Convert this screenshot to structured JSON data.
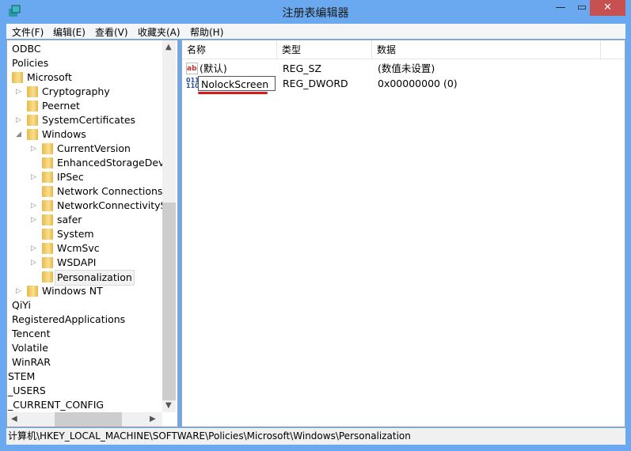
{
  "window": {
    "title": "注册表编辑器",
    "min": "—",
    "max": "▭",
    "close": "✕"
  },
  "menu": [
    "文件(F)",
    "编辑(E)",
    "查看(V)",
    "收藏夹(A)",
    "帮助(H)"
  ],
  "tree": [
    {
      "label": "ODBC",
      "level": 0,
      "folder": false
    },
    {
      "label": "Policies",
      "level": 0,
      "folder": false
    },
    {
      "label": "Microsoft",
      "level": 0,
      "folder": true
    },
    {
      "label": "Cryptography",
      "level": 1,
      "folder": true,
      "expander": "collapsed"
    },
    {
      "label": "Peernet",
      "level": 1,
      "folder": true
    },
    {
      "label": "SystemCertificates",
      "level": 1,
      "folder": true,
      "expander": "collapsed"
    },
    {
      "label": "Windows",
      "level": 1,
      "folder": true,
      "expander": "expanded"
    },
    {
      "label": "CurrentVersion",
      "level": 2,
      "folder": true,
      "expander": "collapsed"
    },
    {
      "label": "EnhancedStorageDevic",
      "level": 2,
      "folder": true
    },
    {
      "label": "IPSec",
      "level": 2,
      "folder": true,
      "expander": "collapsed"
    },
    {
      "label": "Network Connections",
      "level": 2,
      "folder": true
    },
    {
      "label": "NetworkConnectivitySta",
      "level": 2,
      "folder": true,
      "expander": "collapsed"
    },
    {
      "label": "safer",
      "level": 2,
      "folder": true,
      "expander": "collapsed"
    },
    {
      "label": "System",
      "level": 2,
      "folder": true
    },
    {
      "label": "WcmSvc",
      "level": 2,
      "folder": true,
      "expander": "collapsed"
    },
    {
      "label": "WSDAPI",
      "level": 2,
      "folder": true,
      "expander": "collapsed"
    },
    {
      "label": "Personalization",
      "level": 2,
      "folder": true,
      "selected": true
    },
    {
      "label": "Windows NT",
      "level": 1,
      "folder": true,
      "expander": "collapsed"
    },
    {
      "label": "QiYi",
      "level": 0,
      "folder": false
    },
    {
      "label": "RegisteredApplications",
      "level": 0,
      "folder": false
    },
    {
      "label": "Tencent",
      "level": 0,
      "folder": false
    },
    {
      "label": "Volatile",
      "level": 0,
      "folder": false
    },
    {
      "label": "WinRAR",
      "level": 0,
      "folder": false
    },
    {
      "label": "STEM",
      "level": -1,
      "folder": false
    },
    {
      "label": "_USERS",
      "level": -1,
      "folder": false
    },
    {
      "label": "_CURRENT_CONFIG",
      "level": -1,
      "folder": false
    }
  ],
  "list": {
    "columns": [
      "名称",
      "类型",
      "数据"
    ],
    "rows": [
      {
        "icon": "string-value-icon",
        "name": "(默认)",
        "type": "REG_SZ",
        "data": "(数值未设置)"
      },
      {
        "icon": "dword-value-icon",
        "name": "NolockScreen",
        "type": "REG_DWORD",
        "data": "0x00000000 (0)",
        "editing": true
      }
    ]
  },
  "status": "计算机\\HKEY_LOCAL_MACHINE\\SOFTWARE\\Policies\\Microsoft\\Windows\\Personalization",
  "colors": {
    "frame": "#6aa9ef",
    "close": "#c75050",
    "highlight": "#d8181b"
  }
}
